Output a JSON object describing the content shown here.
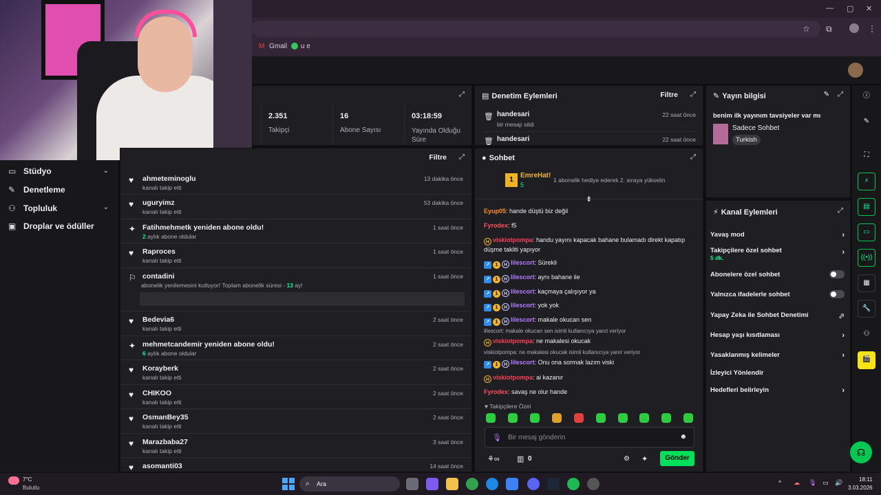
{
  "browser": {
    "bookmarks": [
      "Gmail",
      "u e"
    ]
  },
  "left_nav": [
    {
      "label": "Stüdyo",
      "icon": "monitor-icon",
      "has_chevron": true
    },
    {
      "label": "Denetleme",
      "icon": "wrench-icon",
      "has_chevron": false
    },
    {
      "label": "Topluluk",
      "icon": "people-icon",
      "has_chevron": true
    },
    {
      "label": "Droplar ve ödüller",
      "icon": "gift-icon",
      "has_chevron": false
    }
  ],
  "stats": [
    {
      "value": "2.351",
      "label": "Takipçi"
    },
    {
      "value": "16",
      "label": "Abone Sayısı"
    },
    {
      "value": "03:18:59",
      "label": "Yayında Olduğu Süre"
    }
  ],
  "activity": {
    "filter_label": "Filtre",
    "rows": [
      {
        "name": "ahmeteminoglu",
        "sub": "kanalı takip etti",
        "time": "13 dakika önce",
        "icon": "heart"
      },
      {
        "name": "uguryimz",
        "sub": "kanalı takip etti",
        "time": "53 dakika önce",
        "icon": "heart"
      },
      {
        "name": "Fatihmehmetk yeniden abone oldu!",
        "sub_num": "2",
        "sub": "aylık abone oldular",
        "time": "1 saat önce",
        "icon": "star"
      },
      {
        "name": "Raproces",
        "sub": "kanalı takip etti",
        "time": "1 saat önce",
        "icon": "heart"
      },
      {
        "name": "contadini",
        "sub": "abonelik yenilemesini kutluyor! Toplam abonelik süresi - ",
        "sub_num2": "13",
        "sub_tail": " ay!",
        "time": "1 saat önce",
        "icon": "party"
      },
      {
        "name": "Bedevia6",
        "sub": "kanalı takip etti",
        "time": "2 saat önce",
        "icon": "heart"
      },
      {
        "name": "mehmetcandemir yeniden abone oldu!",
        "sub_num": "6",
        "sub": "aylık abone oldular",
        "time": "2 saat önce",
        "icon": "star"
      },
      {
        "name": "Korayberk",
        "sub": "kanalı takip etti",
        "time": "2 saat önce",
        "icon": "heart"
      },
      {
        "name": "CHIKOO",
        "sub": "kanalı takip etti",
        "time": "2 saat önce",
        "icon": "heart"
      },
      {
        "name": "OsmanBey35",
        "sub": "kanalı takip etti",
        "time": "2 saat önce",
        "icon": "heart"
      },
      {
        "name": "Marazbaba27",
        "sub": "kanalı takip etti",
        "time": "3 saat önce",
        "icon": "heart"
      },
      {
        "name": "asomanti03",
        "sub": "",
        "time": "14 saat önce",
        "icon": "heart"
      }
    ]
  },
  "moderation": {
    "title": "Denetim Eylemleri",
    "filter_label": "Filtre",
    "rows": [
      {
        "name": "handesari",
        "sub": "bir mesajı sildi",
        "time": "22 saat önce"
      },
      {
        "name": "handesari",
        "sub": "",
        "time": "22 saat önce"
      }
    ]
  },
  "chat": {
    "title": "Sohbet",
    "pinned": {
      "rank": "1",
      "user": "EmreHat!",
      "count": "5",
      "text": "1 abonelik hediye ederek 2. sıraya yükselin"
    },
    "messages": [
      {
        "user": "Eyup05",
        "color": "orange",
        "text": "hande düştü biz değil",
        "badges": []
      },
      {
        "user": "Fyrodex",
        "color": "red",
        "text": "f5",
        "badges": []
      },
      {
        "user": "viskiotpompa",
        "color": "pink",
        "text": "handu yayını kapacak bahane bulamadı direkt kapatıp düşme takliti yapıyor",
        "badges": [
          "yh"
        ]
      },
      {
        "user": "lilescort",
        "color": "purple",
        "text": "Sürekli",
        "badges": [
          "blue",
          "gold",
          "hex"
        ]
      },
      {
        "user": "lilescort",
        "color": "purple",
        "text": "aynı bahane ile",
        "badges": [
          "blue",
          "gold",
          "hex"
        ]
      },
      {
        "user": "lilescort",
        "color": "purple",
        "text": "kaçmaya çalışıyor ya",
        "badges": [
          "blue",
          "gold",
          "hex"
        ]
      },
      {
        "user": "lilescort",
        "color": "purple",
        "text": "yok yok",
        "badges": [
          "blue",
          "gold",
          "hex"
        ]
      },
      {
        "user": "lilescort",
        "color": "purple",
        "text": "makale okucan sen",
        "badges": [
          "blue",
          "gold",
          "hex"
        ]
      },
      {
        "reply": "illescort: makale okucan sen isimli kullanıcıya yanıt veriyor",
        "user": "viskiotpompa",
        "color": "pink",
        "text": "ne makalesi okucak",
        "badges": [
          "yh"
        ]
      },
      {
        "reply": "viskiotpompa: ne makalesi okucak isimli kullanıcıya yanıt veriyor",
        "user": "lilescort",
        "color": "purple",
        "text": "Onu ona sormak lazım viski",
        "badges": [
          "blue",
          "gold",
          "hex"
        ]
      },
      {
        "user": "viskiotpompa",
        "color": "pink",
        "text": "ai kazanır",
        "badges": [
          "yh"
        ]
      },
      {
        "user": "Fyrodex",
        "color": "red",
        "text": "savaş ne olur hande",
        "badges": []
      }
    ],
    "emote_section": "Takipçilere Özel",
    "input_placeholder": "Bir mesaj gönderin",
    "points": "0",
    "send_label": "Gönder"
  },
  "stream_info": {
    "title": "Yayın bilgisi",
    "stream_title": "benim ilk yayınım tavsiyeler var mı",
    "category": "Sadece Sohbet",
    "tag": "Turkish"
  },
  "channel_actions": {
    "title": "Kanal Eylemleri",
    "items": [
      {
        "label": "Yavaş mod",
        "sub": "",
        "control": "arrow"
      },
      {
        "label": "Takipçilere özel sohbet",
        "sub": "5 dk.",
        "control": "arrow"
      },
      {
        "label": "Abonelere özel sohbet",
        "sub": "",
        "control": "toggle"
      },
      {
        "label": "Yalnızca ifadelerle sohbet",
        "sub": "",
        "control": "toggle"
      },
      {
        "label": "Yapay Zeka ile Sohbet Denetimi",
        "sub": "",
        "control": "external"
      },
      {
        "label": "Hesap yaşı kısıtlaması",
        "sub": "",
        "control": "arrow"
      },
      {
        "label": "Yasaklanmış kelimeler",
        "sub": "",
        "control": "arrow"
      },
      {
        "label": "İzleyici Yönlendir",
        "sub": "",
        "control": "none"
      },
      {
        "label": "Hedefleri belirleyin",
        "sub": "",
        "control": "arrow"
      }
    ]
  },
  "taskbar": {
    "temp": "7°C",
    "weather": "Bulutlu",
    "search": "Ara",
    "time": "18:11",
    "date": "3.03.2026"
  },
  "colors": {
    "accent_green": "#00f593",
    "panel": "#1f1f23",
    "send_button": "#00e05a"
  }
}
